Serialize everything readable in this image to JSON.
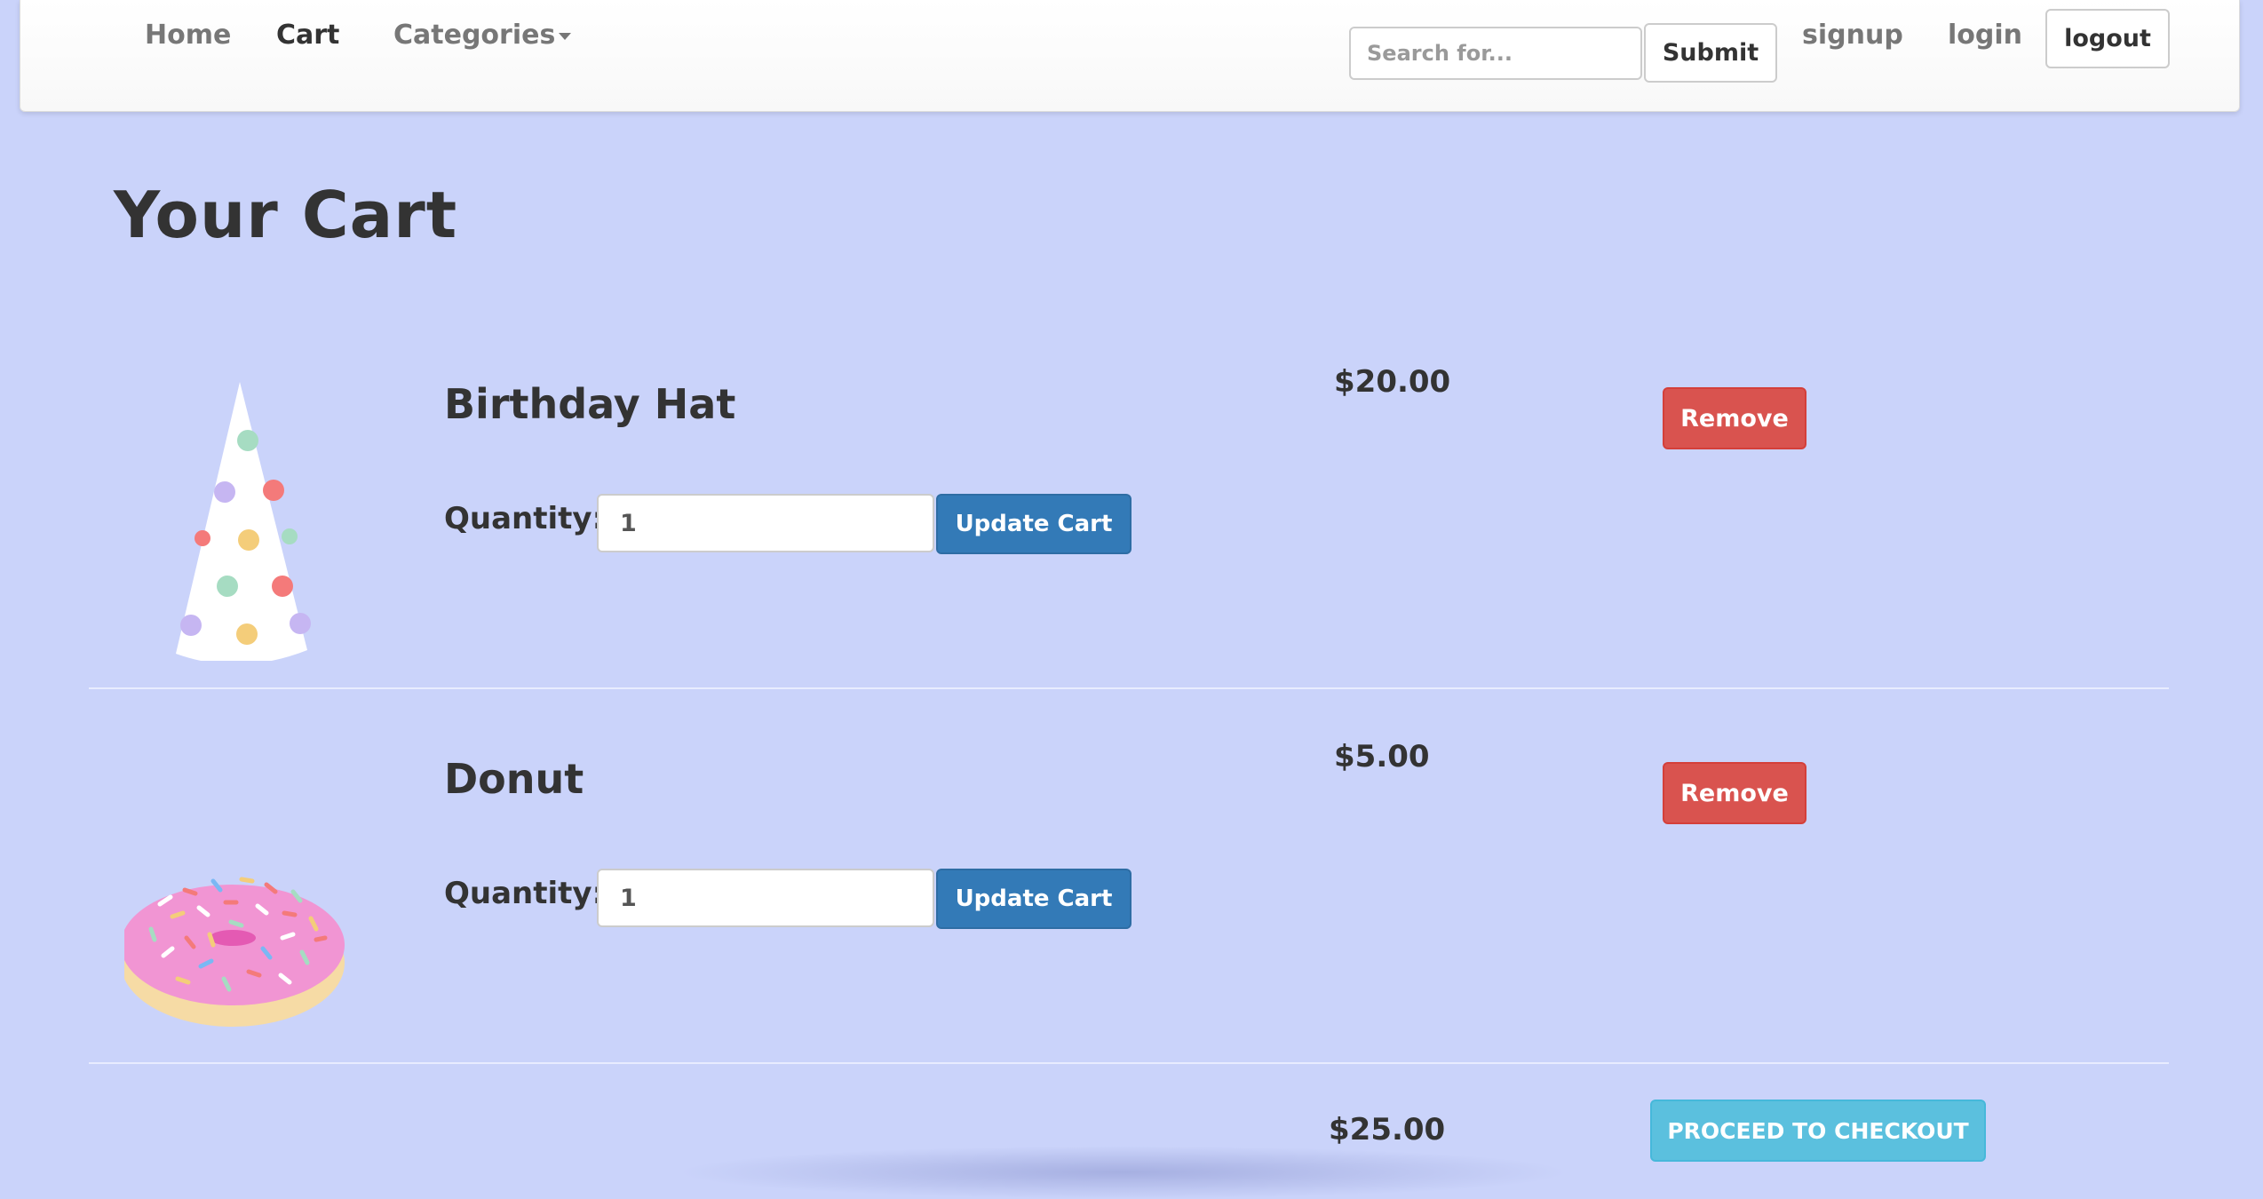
{
  "navbar": {
    "home": "Home",
    "cart": "Cart",
    "categories": "Categories",
    "search_placeholder": "Search for...",
    "submit": "Submit",
    "signup": "signup",
    "login": "login",
    "logout": "logout"
  },
  "page": {
    "title": "Your Cart"
  },
  "cart": {
    "items": [
      {
        "name": "Birthday Hat",
        "quantity_label": "Quantity:",
        "quantity": "1",
        "update_label": "Update Cart",
        "price": "$20.00",
        "remove_label": "Remove",
        "icon": "party-hat-icon"
      },
      {
        "name": "Donut",
        "quantity_label": "Quantity:",
        "quantity": "1",
        "update_label": "Update Cart",
        "price": "$5.00",
        "remove_label": "Remove",
        "icon": "donut-icon"
      }
    ],
    "total": "$25.00",
    "checkout_label": "PROCEED TO CHECKOUT"
  },
  "colors": {
    "background": "#cad3fa",
    "primary": "#337ab7",
    "danger": "#d9534f",
    "info": "#5bc0de"
  }
}
